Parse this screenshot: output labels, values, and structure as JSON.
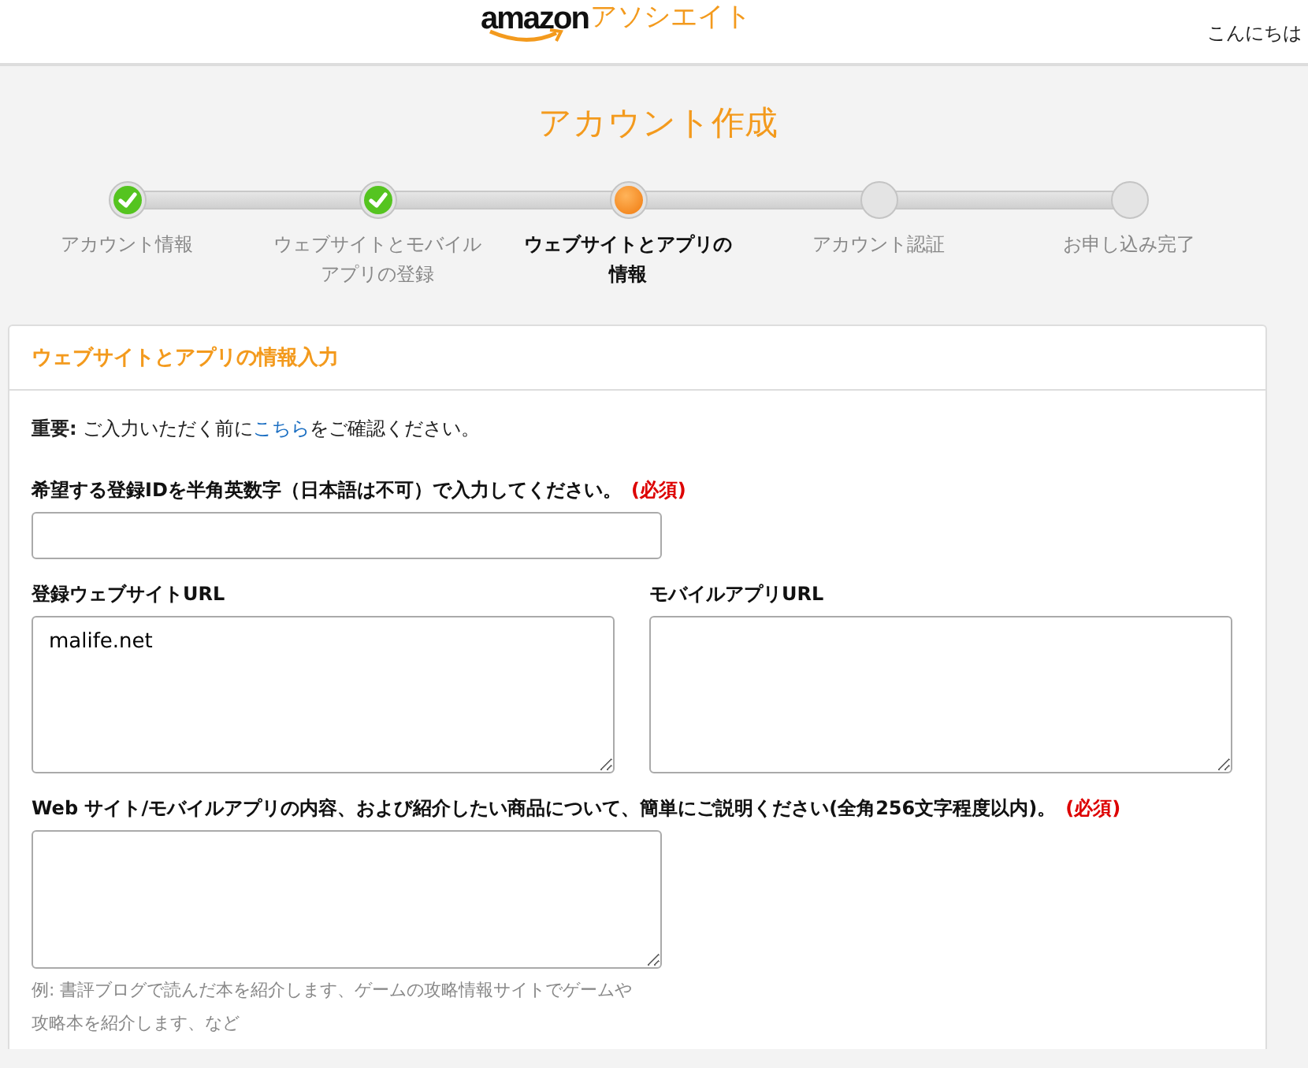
{
  "header": {
    "logo_word": "amazon",
    "logo_suffix": "アソシエイト",
    "greeting": "こんにちは"
  },
  "page_title": "アカウント作成",
  "steps": [
    {
      "label": "アカウント情報",
      "completed": true,
      "selected": false
    },
    {
      "label": "ウェブサイトとモバイルアプリの登録",
      "completed": true,
      "selected": false
    },
    {
      "label": "ウェブサイトとアプリの情報",
      "completed": false,
      "selected": true
    },
    {
      "label": "アカウント認証",
      "completed": false,
      "selected": false
    },
    {
      "label": "お申し込み完了",
      "completed": false,
      "selected": false
    }
  ],
  "card": {
    "title": "ウェブサイトとアプリの情報入力",
    "notice": {
      "bold": "重要:",
      "before": "ご入力いただく前に",
      "link": "こちら",
      "after": "をご確認ください。"
    },
    "fields": [
      {
        "kind": "input",
        "label": "希望する登録IDを半角英数字（日本語は不可）で入力してください。",
        "required": "(必須)"
      },
      {
        "kind": "pair",
        "items": [
          {
            "label": "登録ウェブサイトURL",
            "value": "malife.net"
          },
          {
            "label": "モバイルアプリURL"
          }
        ]
      },
      {
        "kind": "textarea",
        "label": "Web サイト/モバイルアプリの内容、および紹介したい商品について、簡単にご説明ください(全角256文字程度以内)。",
        "required": "(必須)",
        "hint": "例: 書評ブログで読んだ本を紹介します、ゲームの攻略情報サイトでゲームや攻略本を紹介します、など"
      }
    ]
  }
}
